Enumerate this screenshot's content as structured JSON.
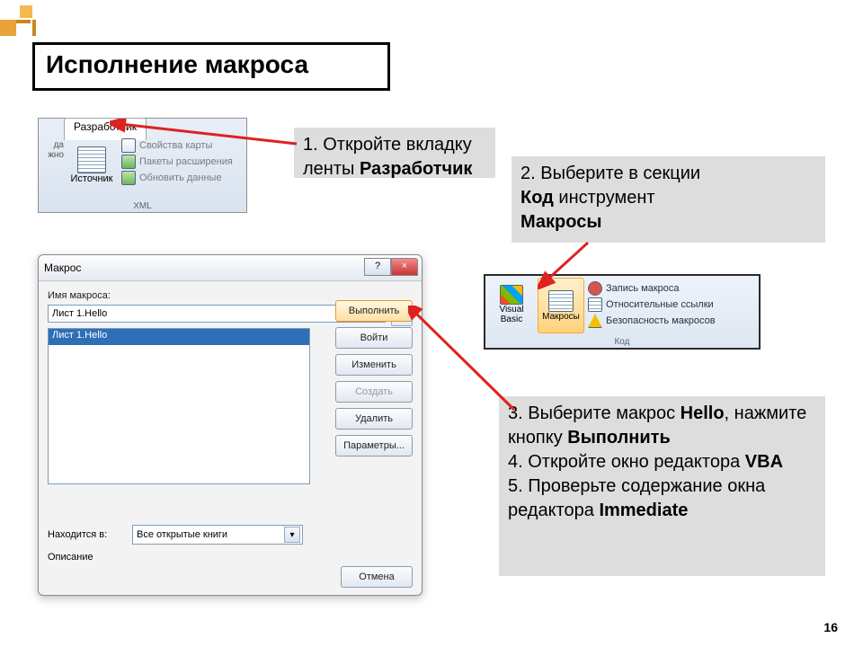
{
  "title": "Исполнение макроса",
  "page_number": "16",
  "callouts": {
    "step1_a": "1. Откройте вкладку",
    "step1_b": "ленты ",
    "step1_bold": "Разработчик",
    "step2_a": "2. Выберите в секции ",
    "step2_b1": "Код",
    "step2_c": " инструмент ",
    "step2_b2": "Макросы",
    "step3_a": "3. Выберите макрос ",
    "step3_b1": "Hello",
    "step3_c": ", нажмите кнопку ",
    "step3_b2": "Выполнить",
    "step4": "4. Откройте окно редактора ",
    "step4_b": "VBA",
    "step5_a": "5. Проверьте  содержание окна редактора ",
    "step5_b": "Immediate"
  },
  "ribbon1": {
    "tab": "Разработчик",
    "left_partial1": "да",
    "left_partial2": "жно",
    "source_btn": "Источник",
    "item1": "Свойства карты",
    "item2": "Пакеты расширения",
    "item3": "Обновить данные",
    "group": "XML"
  },
  "ribbon2": {
    "vb_line1": "Visual",
    "vb_line2": "Basic",
    "macros": "Макросы",
    "rec": "Запись макроса",
    "rel": "Относительные ссылки",
    "sec": "Безопасность макросов",
    "group": "Код"
  },
  "dialog": {
    "title": "Макрос",
    "name_label": "Имя макроса:",
    "name_value": "Лист 1.Hello",
    "list_item": "Лист 1.Hello",
    "btn_run": "Выполнить",
    "btn_step": "Войти",
    "btn_edit": "Изменить",
    "btn_create": "Создать",
    "btn_delete": "Удалить",
    "btn_options": "Параметры...",
    "loc_label": "Находится в:",
    "loc_value": "Все открытые книги",
    "desc_label": "Описание",
    "btn_cancel": "Отмена",
    "help_symbol": "?",
    "close_symbol": "×",
    "combo_arrow": "▾"
  }
}
